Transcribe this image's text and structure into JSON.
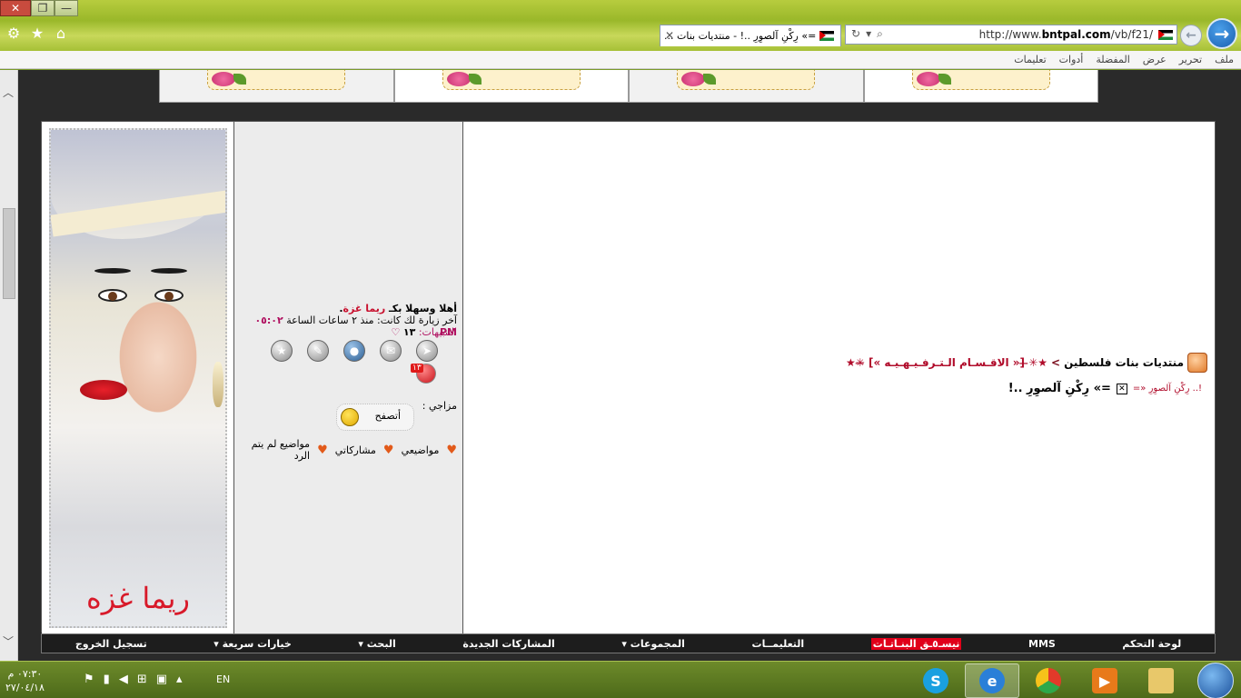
{
  "browser": {
    "window_buttons": [
      "✕",
      "❐",
      "—"
    ],
    "address_url_prefix": "http://www.",
    "address_url_domain": "bntpal.com",
    "address_url_path": "/vb/f21/",
    "tab_title": "=» رِكْنِ آلصوِرِ ..! - منتديات بنات ...",
    "menu": [
      "ملف",
      "تحرير",
      "عرض",
      "المفضلة",
      "أدوات",
      "تعليمات"
    ]
  },
  "profile": {
    "portrait_name": "ريما غزه",
    "welcome_prefix": "أهلا وسهلا بكـ",
    "username": "ريما غزة",
    "welcome_suffix": ".",
    "last_visit": "آخر زيارة لك كانت: منذ ٢ ساعات الساعة",
    "last_visit_time": "٠٥:٠٢ PM",
    "alerts_label": "التنبيهات:",
    "alerts_count": "١٣",
    "notif_badge": "١٣",
    "mood_label": "مزاجي :",
    "mood_value": "أتصفح",
    "links": [
      "مواضيعي",
      "مشاركاتي",
      "مواضيع لم يتم الرد"
    ]
  },
  "content": {
    "bc_home": "منتديات بنات فلسطين",
    "bc_sep": ">",
    "bc_section": "★✳̶ [« الاقـسـام الـتـرفـيـهـيـه »] ̶✳★",
    "sub_small": "!.. رِكْنِ آلصوِرِ «=",
    "sub_title": "=» رِكْنِ آلصوِرِ ..!"
  },
  "bottom_nav": [
    "لوحة التحكم",
    "MMS",
    "نيسـ٥ـق البنـاتـات",
    "التعليمــات",
    "المجموعات ▾",
    "المشاركات الجديدة",
    "البحث ▾",
    "خيارات سريعة ▾",
    "تسجيل الخروج"
  ],
  "taskbar": {
    "time": "٠٧:٣٠ م",
    "date": "٢٧/٠٤/١٨",
    "lang": "EN"
  }
}
